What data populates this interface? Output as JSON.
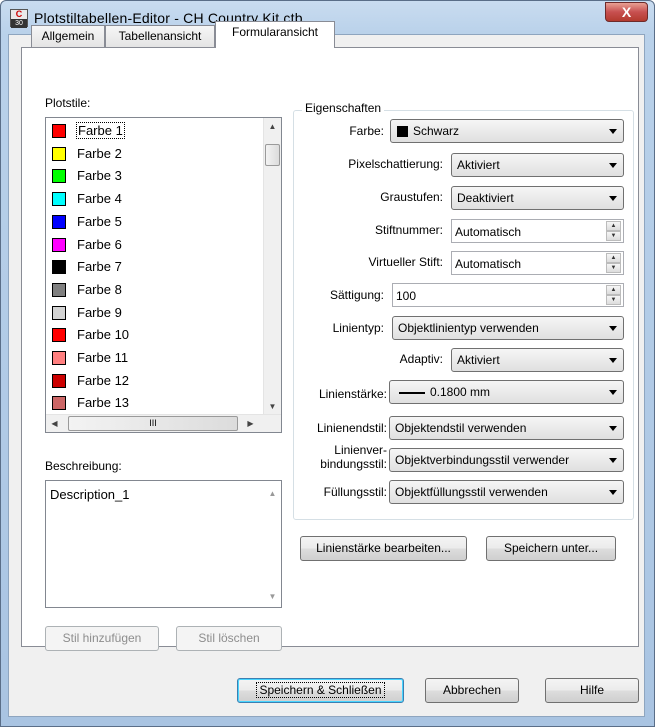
{
  "window": {
    "title": "Plotstiltabellen-Editor - CH Country Kit.ctb",
    "close_label": "X",
    "icon_letter": "C",
    "icon_num": "30"
  },
  "tabs": [
    {
      "label": "Allgemein"
    },
    {
      "label": "Tabellenansicht"
    },
    {
      "label": "Formularansicht"
    }
  ],
  "plotstile": {
    "label": "Plotstile:",
    "items": [
      {
        "label": "Farbe 1",
        "color": "#ff0000"
      },
      {
        "label": "Farbe 2",
        "color": "#ffff00"
      },
      {
        "label": "Farbe 3",
        "color": "#00ff00"
      },
      {
        "label": "Farbe 4",
        "color": "#00ffff"
      },
      {
        "label": "Farbe 5",
        "color": "#0000ff"
      },
      {
        "label": "Farbe 6",
        "color": "#ff00ff"
      },
      {
        "label": "Farbe 7",
        "color": "#000000"
      },
      {
        "label": "Farbe 8",
        "color": "#808080"
      },
      {
        "label": "Farbe 9",
        "color": "#d3d3d3"
      },
      {
        "label": "Farbe 10",
        "color": "#ff0000"
      },
      {
        "label": "Farbe 11",
        "color": "#ff7f7f"
      },
      {
        "label": "Farbe 12",
        "color": "#cc0000"
      },
      {
        "label": "Farbe 13",
        "color": "#cc6666"
      }
    ],
    "hscroll_thumb_label": "III"
  },
  "beschreibung": {
    "label": "Beschreibung:",
    "value": "Description_1"
  },
  "buttons": {
    "stil_hinzufuegen": "Stil hinzufügen",
    "stil_loeschen": "Stil löschen",
    "linienstaerke_bearbeiten": "Linienstärke bearbeiten...",
    "speichern_unter": "Speichern unter...",
    "speichern_schliessen": "Speichern & Schließen",
    "abbrechen": "Abbrechen",
    "hilfe": "Hilfe"
  },
  "eigenschaften": {
    "title": "Eigenschaften",
    "farbe": {
      "label": "Farbe:",
      "value": "Schwarz",
      "swatch": "#000000"
    },
    "pixelschattierung": {
      "label": "Pixelschattierung:",
      "value": "Aktiviert"
    },
    "graustufen": {
      "label": "Graustufen:",
      "value": "Deaktiviert"
    },
    "stiftnummer": {
      "label": "Stiftnummer:",
      "value": "Automatisch"
    },
    "virtueller_stift": {
      "label": "Virtueller Stift:",
      "value": "Automatisch"
    },
    "saettigung": {
      "label": "Sättigung:",
      "value": "100"
    },
    "linientyp": {
      "label": "Linientyp:",
      "value": "Objektlinientyp verwenden"
    },
    "adaptiv": {
      "label": "Adaptiv:",
      "value": "Aktiviert"
    },
    "linienstaerke": {
      "label": "Linienstärke:",
      "value": "0.1800 mm"
    },
    "linienendstil": {
      "label": "Linienendstil:",
      "value": "Objektendstil verwenden"
    },
    "linienverbindungsstil": {
      "label_line1": "Linienver-",
      "label_line2": "bindungsstil:",
      "value": "Objektverbindungsstil verwender"
    },
    "fuellungsstil": {
      "label": "Füllungsstil:",
      "value": "Objektfüllungsstil verwenden"
    }
  }
}
